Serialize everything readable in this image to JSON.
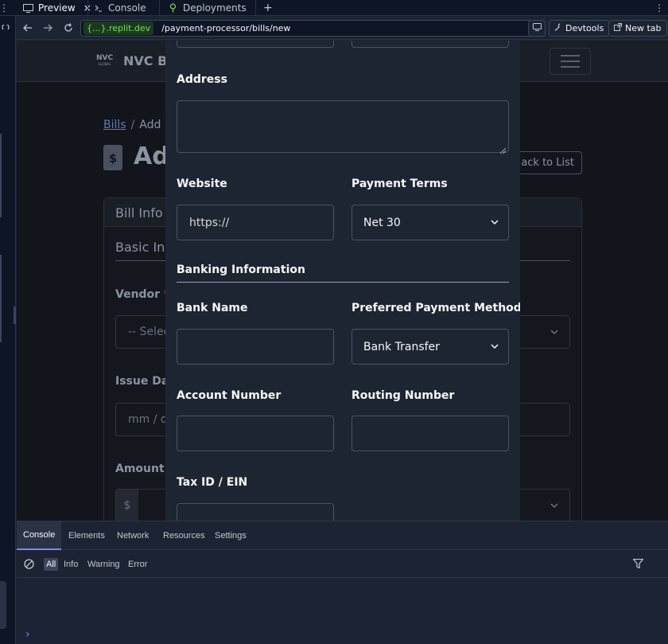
{
  "tabbar": {
    "tabs": [
      {
        "label": "Preview",
        "icon": "monitor-icon",
        "active": true,
        "close": "×"
      },
      {
        "label": "Console",
        "icon": "terminal-icon",
        "active": false
      },
      {
        "label": "Deployments",
        "icon": "deploy-icon",
        "active": false
      }
    ],
    "add": "+",
    "more": "⋮"
  },
  "addressbar": {
    "host": "{...}.replit.dev",
    "path": "/payment-processor/bills/new",
    "devtools_label": "Devtools",
    "newtab_label": "New tab"
  },
  "app": {
    "logo_text": "NVC",
    "logo_sub": "GLOBAL",
    "brand": "NVC Ba",
    "breadcrumb_link": "Bills",
    "breadcrumb_sep": "/",
    "breadcrumb_current": "Add",
    "page_title": "Ad",
    "back_label": "ack to List",
    "card_title": "Bill Info",
    "section_title": "Basic In",
    "vendor_label": "Vendor",
    "vendor_value": "-- Selec",
    "issue_label": "Issue Dat",
    "issue_value": "mm / d",
    "amount_label": "Amount",
    "amount_prefix": "$",
    "required": "*"
  },
  "modal": {
    "address_label": "Address",
    "website_label": "Website",
    "website_value": "https://",
    "terms_label": "Payment Terms",
    "terms_value": "Net 30",
    "banking_title": "Banking Information",
    "bank_name_label": "Bank Name",
    "method_label": "Preferred Payment Method",
    "method_value": "Bank Transfer",
    "account_label": "Account Number",
    "routing_label": "Routing Number",
    "tax_label": "Tax ID / EIN"
  },
  "devtools": {
    "tabs": [
      "Console",
      "Elements",
      "Network",
      "Resources",
      "Settings"
    ],
    "filters": [
      "All",
      "Info",
      "Warning",
      "Error"
    ],
    "prompt": "›"
  }
}
